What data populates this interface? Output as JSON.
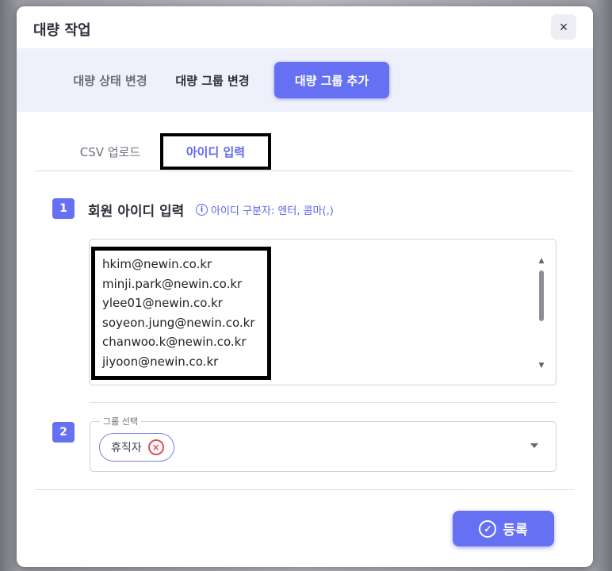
{
  "modal": {
    "title": "대량 작업",
    "close_icon": "×"
  },
  "main_tabs": [
    {
      "label": "대량 상태 변경",
      "active": false
    },
    {
      "label": "대량 그룹 변경",
      "active": false
    },
    {
      "label": "대량 그룹 추가",
      "active": true
    }
  ],
  "sub_tabs": [
    {
      "label": "CSV 업로드",
      "active": false
    },
    {
      "label": "아이디 입력",
      "active": true
    }
  ],
  "step1": {
    "number": "1",
    "title": "회원 아이디 입력",
    "hint_icon": "i",
    "hint": "아이디 구분자: 엔터, 콤마(,)",
    "ids": [
      "hkim@newin.co.kr",
      "minji.park@newin.co.kr",
      "ylee01@newin.co.kr",
      "soyeon.jung@newin.co.kr",
      "chanwoo.k@newin.co.kr",
      "jiyoon@newin.co.kr"
    ]
  },
  "step2": {
    "number": "2",
    "legend": "그룹 선택",
    "selected_chip": "휴직자",
    "chip_remove_icon": "×"
  },
  "footer": {
    "submit_label": "등록",
    "submit_icon": "✓"
  },
  "colors": {
    "accent": "#6670f2",
    "tabbar_bg": "#eef0fb",
    "chip_remove": "#e14c5c"
  }
}
